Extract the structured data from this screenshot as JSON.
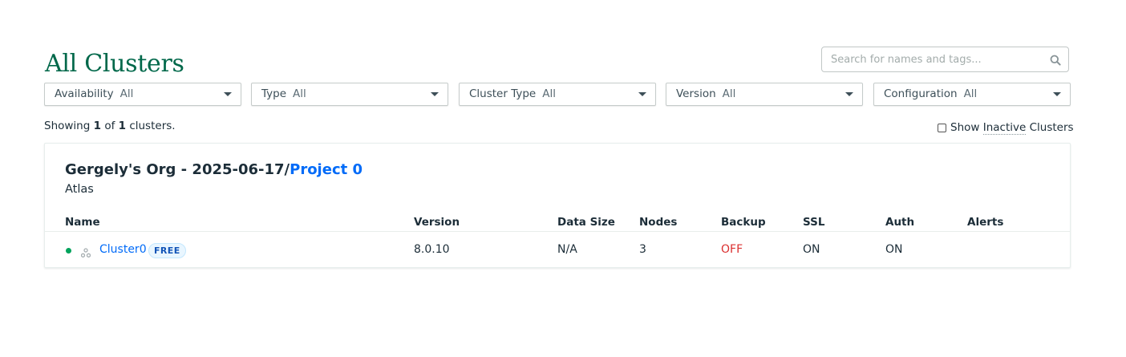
{
  "page": {
    "title": "All Clusters"
  },
  "search": {
    "placeholder": "Search for names and tags...",
    "icon": "search-icon"
  },
  "filters": [
    {
      "label": "Availability",
      "value": "All"
    },
    {
      "label": "Type",
      "value": "All"
    },
    {
      "label": "Cluster Type",
      "value": "All"
    },
    {
      "label": "Version",
      "value": "All"
    },
    {
      "label": "Configuration",
      "value": "All"
    }
  ],
  "summary": {
    "prefix": "Showing",
    "shown": "1",
    "of": "of",
    "total": "1",
    "suffix": "clusters."
  },
  "show_inactive": {
    "label_prefix": "Show",
    "label_underlined": "Inactive",
    "label_suffix": "Clusters",
    "checked": false
  },
  "project": {
    "org": "Gergely's Org - 2025-06-17/",
    "name": "Project 0",
    "subtitle": "Atlas"
  },
  "table": {
    "columns": [
      "Name",
      "Version",
      "Data Size",
      "Nodes",
      "Backup",
      "SSL",
      "Auth",
      "Alerts"
    ],
    "rows": [
      {
        "name": "Cluster0",
        "badge": "FREE",
        "version": "8.0.10",
        "data_size": "N/A",
        "nodes": "3",
        "backup": "OFF",
        "ssl": "ON",
        "auth": "ON",
        "alerts": ""
      }
    ]
  },
  "colors": {
    "title_green": "#00684a",
    "link_blue": "#016bf8",
    "status_green": "#00a35c",
    "backup_off_red": "#db3030",
    "badge_bg": "#e9f6ff"
  }
}
